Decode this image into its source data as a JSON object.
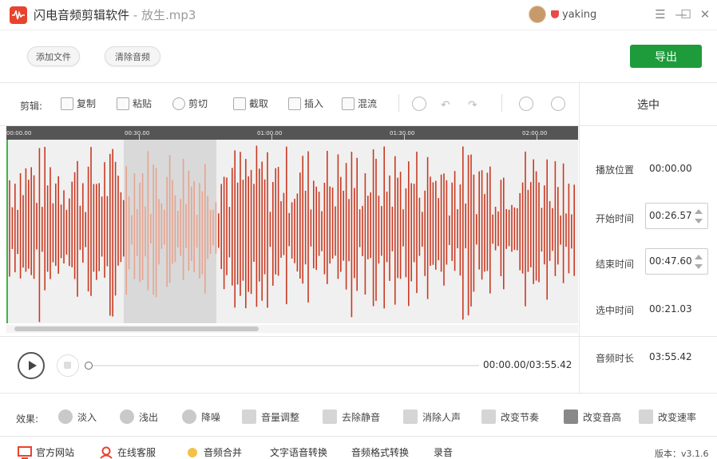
{
  "app": {
    "title": "闪电音频剪辑软件",
    "separator": " - ",
    "file": "放生.mp3",
    "username": "yaking"
  },
  "window_controls": {
    "menu": "☰",
    "minimize": "—",
    "maximize": "☐",
    "close": "✕"
  },
  "top_buttons": {
    "add_file": "添加文件",
    "clear_audio": "清除音频",
    "export": "导出"
  },
  "edit_toolbar": {
    "label": "剪辑:",
    "copy": "复制",
    "paste": "粘贴",
    "cut": "剪切",
    "crop": "截取",
    "insert": "插入",
    "mix": "混流"
  },
  "right_panel": {
    "header": "选中",
    "rows": [
      {
        "label": "播放位置",
        "value": "00:00.00"
      },
      {
        "label": "开始时间",
        "value": "00:26.57"
      },
      {
        "label": "结束时间",
        "value": "00:47.60"
      },
      {
        "label": "选中时间",
        "value": "00:21.03"
      },
      {
        "label": "音频时长",
        "value": "03:55.42"
      }
    ]
  },
  "timeline": {
    "ticks": [
      "00:00.00",
      "00:30.00",
      "01:00.00",
      "01:30.00",
      "02:00.00"
    ]
  },
  "player": {
    "time": "00:00.00/03:55.42",
    "progress": 0
  },
  "waveform": {
    "selection_start": "00:26.57",
    "selection_end": "00:47.60",
    "color": "#c83a22",
    "selected_color": "#e7a38f"
  },
  "effects": {
    "label": "效果:",
    "items": [
      "淡入",
      "浅出",
      "降噪",
      "音量调整",
      "去除静音",
      "消除人声",
      "改变节奏",
      "改变音高",
      "改变速率"
    ]
  },
  "bottom": {
    "website": "官方网站",
    "support": "在线客服",
    "merge": "音频合并",
    "tts": "文字语音转换",
    "convert": "音频格式转换",
    "record": "录音",
    "version": "版本：v3.1.6"
  },
  "colors": {
    "accent_green": "#1e9b3b",
    "brand_red": "#e8432c"
  }
}
